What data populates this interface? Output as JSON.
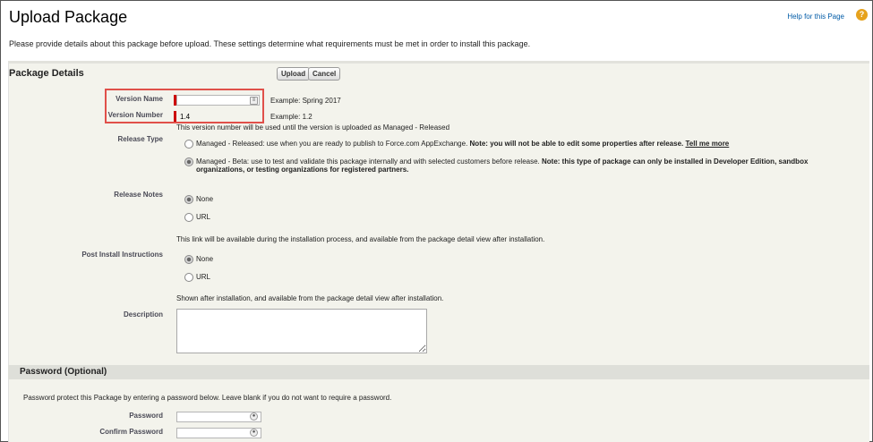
{
  "page": {
    "title": "Upload Package",
    "help_link": "Help for this Page",
    "help_icon": "?",
    "intro": "Please provide details about this package before upload. These settings determine what requirements must be met in order to install this package."
  },
  "section": {
    "heading": "Package Details",
    "upload_label": "Upload",
    "cancel_label": "Cancel"
  },
  "fields": {
    "version_name": {
      "label": "Version Name",
      "value": "",
      "example": "Example: Spring 2017"
    },
    "version_number": {
      "label": "Version Number",
      "value": "1.4",
      "example": "Example: 1.2",
      "note": "This version number will be used until the version is uploaded as Managed - Released"
    },
    "release_type": {
      "label": "Release Type",
      "managed_released": {
        "text": "Managed - Released: use when you are ready to publish to Force.com AppExchange.",
        "note": "Note: you will not be able to edit some properties after release.",
        "link": "Tell me more",
        "selected": false
      },
      "managed_beta": {
        "text": "Managed - Beta: use to test and validate this package internally and with selected customers before release.",
        "note_line1": "Note: this type of package can only be installed in Developer Edition, sandbox",
        "note_line2": "organizations, or testing organizations for registered partners.",
        "selected": true
      }
    },
    "release_notes": {
      "label": "Release Notes",
      "opt_none": "None",
      "opt_url": "URL",
      "note": "This link will be available during the installation process, and available from the package detail view after installation."
    },
    "post_install": {
      "label": "Post Install Instructions",
      "opt_none": "None",
      "opt_url": "URL",
      "note": "Shown after installation, and available from the package detail view after installation."
    },
    "description": {
      "label": "Description"
    }
  },
  "password": {
    "heading": "Password (Optional)",
    "intro": "Password protect this Package by entering a password below. Leave blank if you do not want to require a password.",
    "password_label": "Password",
    "confirm_label": "Confirm Password"
  },
  "colors": {
    "highlight": "#e0504a",
    "required": "#cc0000",
    "panel_bg": "#f3f3ec",
    "link": "#015ba7"
  }
}
